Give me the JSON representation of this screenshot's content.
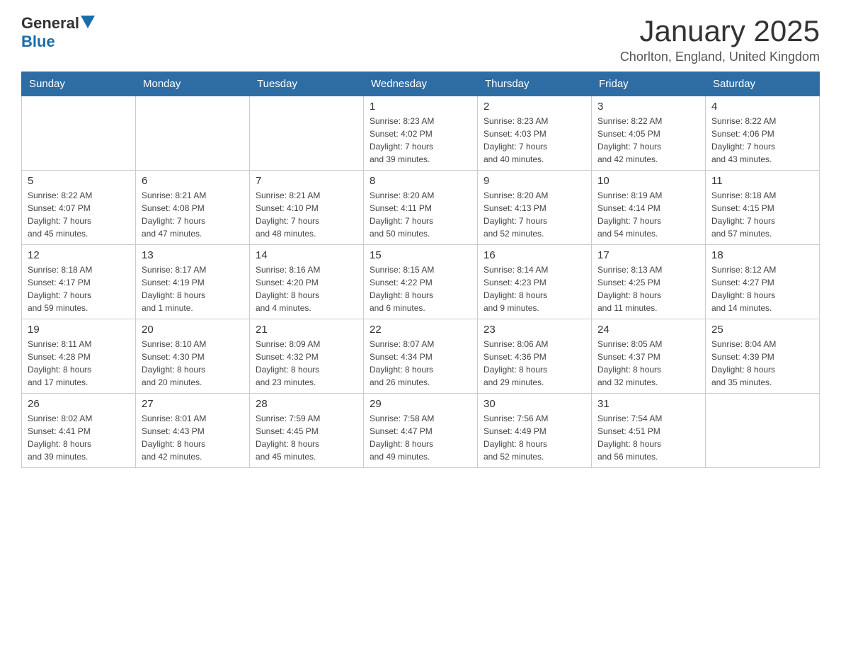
{
  "header": {
    "logo_general": "General",
    "logo_blue": "Blue",
    "title": "January 2025",
    "subtitle": "Chorlton, England, United Kingdom"
  },
  "weekdays": [
    "Sunday",
    "Monday",
    "Tuesday",
    "Wednesday",
    "Thursday",
    "Friday",
    "Saturday"
  ],
  "weeks": [
    [
      {
        "day": "",
        "info": ""
      },
      {
        "day": "",
        "info": ""
      },
      {
        "day": "",
        "info": ""
      },
      {
        "day": "1",
        "info": "Sunrise: 8:23 AM\nSunset: 4:02 PM\nDaylight: 7 hours\nand 39 minutes."
      },
      {
        "day": "2",
        "info": "Sunrise: 8:23 AM\nSunset: 4:03 PM\nDaylight: 7 hours\nand 40 minutes."
      },
      {
        "day": "3",
        "info": "Sunrise: 8:22 AM\nSunset: 4:05 PM\nDaylight: 7 hours\nand 42 minutes."
      },
      {
        "day": "4",
        "info": "Sunrise: 8:22 AM\nSunset: 4:06 PM\nDaylight: 7 hours\nand 43 minutes."
      }
    ],
    [
      {
        "day": "5",
        "info": "Sunrise: 8:22 AM\nSunset: 4:07 PM\nDaylight: 7 hours\nand 45 minutes."
      },
      {
        "day": "6",
        "info": "Sunrise: 8:21 AM\nSunset: 4:08 PM\nDaylight: 7 hours\nand 47 minutes."
      },
      {
        "day": "7",
        "info": "Sunrise: 8:21 AM\nSunset: 4:10 PM\nDaylight: 7 hours\nand 48 minutes."
      },
      {
        "day": "8",
        "info": "Sunrise: 8:20 AM\nSunset: 4:11 PM\nDaylight: 7 hours\nand 50 minutes."
      },
      {
        "day": "9",
        "info": "Sunrise: 8:20 AM\nSunset: 4:13 PM\nDaylight: 7 hours\nand 52 minutes."
      },
      {
        "day": "10",
        "info": "Sunrise: 8:19 AM\nSunset: 4:14 PM\nDaylight: 7 hours\nand 54 minutes."
      },
      {
        "day": "11",
        "info": "Sunrise: 8:18 AM\nSunset: 4:15 PM\nDaylight: 7 hours\nand 57 minutes."
      }
    ],
    [
      {
        "day": "12",
        "info": "Sunrise: 8:18 AM\nSunset: 4:17 PM\nDaylight: 7 hours\nand 59 minutes."
      },
      {
        "day": "13",
        "info": "Sunrise: 8:17 AM\nSunset: 4:19 PM\nDaylight: 8 hours\nand 1 minute."
      },
      {
        "day": "14",
        "info": "Sunrise: 8:16 AM\nSunset: 4:20 PM\nDaylight: 8 hours\nand 4 minutes."
      },
      {
        "day": "15",
        "info": "Sunrise: 8:15 AM\nSunset: 4:22 PM\nDaylight: 8 hours\nand 6 minutes."
      },
      {
        "day": "16",
        "info": "Sunrise: 8:14 AM\nSunset: 4:23 PM\nDaylight: 8 hours\nand 9 minutes."
      },
      {
        "day": "17",
        "info": "Sunrise: 8:13 AM\nSunset: 4:25 PM\nDaylight: 8 hours\nand 11 minutes."
      },
      {
        "day": "18",
        "info": "Sunrise: 8:12 AM\nSunset: 4:27 PM\nDaylight: 8 hours\nand 14 minutes."
      }
    ],
    [
      {
        "day": "19",
        "info": "Sunrise: 8:11 AM\nSunset: 4:28 PM\nDaylight: 8 hours\nand 17 minutes."
      },
      {
        "day": "20",
        "info": "Sunrise: 8:10 AM\nSunset: 4:30 PM\nDaylight: 8 hours\nand 20 minutes."
      },
      {
        "day": "21",
        "info": "Sunrise: 8:09 AM\nSunset: 4:32 PM\nDaylight: 8 hours\nand 23 minutes."
      },
      {
        "day": "22",
        "info": "Sunrise: 8:07 AM\nSunset: 4:34 PM\nDaylight: 8 hours\nand 26 minutes."
      },
      {
        "day": "23",
        "info": "Sunrise: 8:06 AM\nSunset: 4:36 PM\nDaylight: 8 hours\nand 29 minutes."
      },
      {
        "day": "24",
        "info": "Sunrise: 8:05 AM\nSunset: 4:37 PM\nDaylight: 8 hours\nand 32 minutes."
      },
      {
        "day": "25",
        "info": "Sunrise: 8:04 AM\nSunset: 4:39 PM\nDaylight: 8 hours\nand 35 minutes."
      }
    ],
    [
      {
        "day": "26",
        "info": "Sunrise: 8:02 AM\nSunset: 4:41 PM\nDaylight: 8 hours\nand 39 minutes."
      },
      {
        "day": "27",
        "info": "Sunrise: 8:01 AM\nSunset: 4:43 PM\nDaylight: 8 hours\nand 42 minutes."
      },
      {
        "day": "28",
        "info": "Sunrise: 7:59 AM\nSunset: 4:45 PM\nDaylight: 8 hours\nand 45 minutes."
      },
      {
        "day": "29",
        "info": "Sunrise: 7:58 AM\nSunset: 4:47 PM\nDaylight: 8 hours\nand 49 minutes."
      },
      {
        "day": "30",
        "info": "Sunrise: 7:56 AM\nSunset: 4:49 PM\nDaylight: 8 hours\nand 52 minutes."
      },
      {
        "day": "31",
        "info": "Sunrise: 7:54 AM\nSunset: 4:51 PM\nDaylight: 8 hours\nand 56 minutes."
      },
      {
        "day": "",
        "info": ""
      }
    ]
  ]
}
